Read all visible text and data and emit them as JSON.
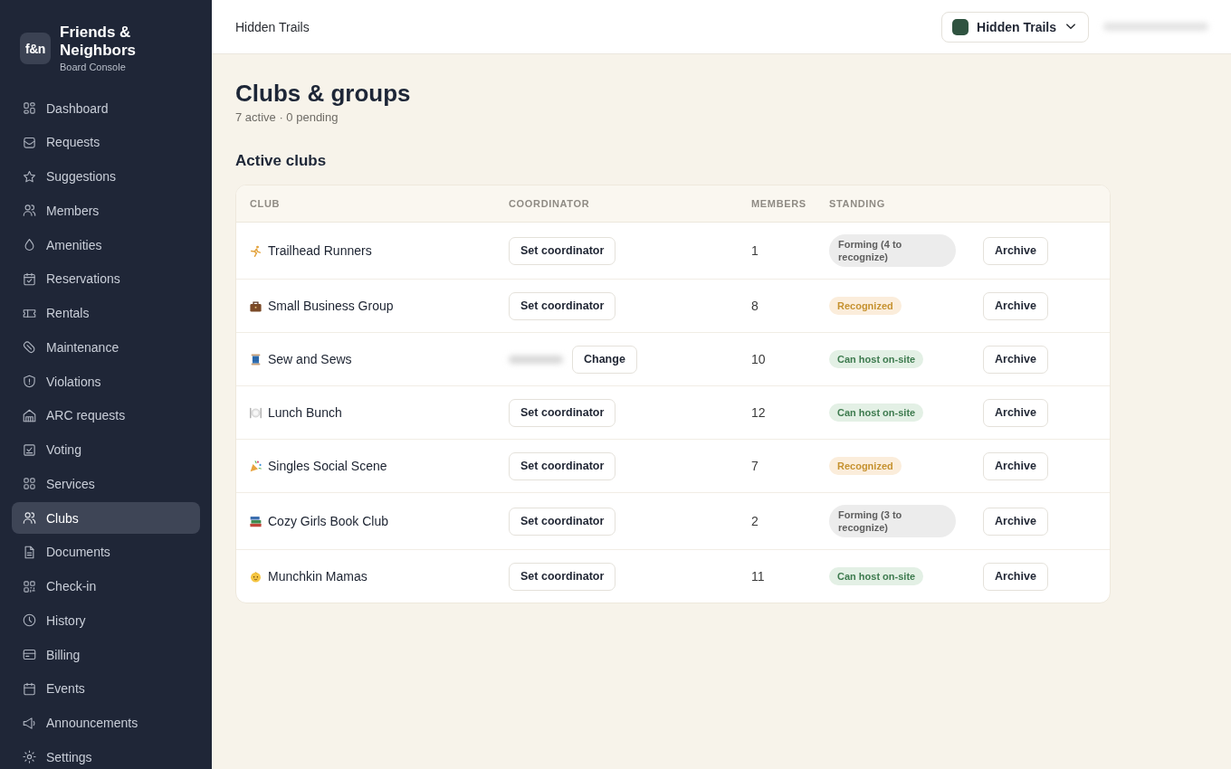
{
  "sidebar": {
    "brand": {
      "logo": "f&n",
      "name": "Friends & Neighbors",
      "subtitle": "Board Console"
    },
    "items": [
      {
        "label": "Dashboard",
        "kind": "layout",
        "selected": false
      },
      {
        "label": "Requests",
        "kind": "inbox",
        "selected": false
      },
      {
        "label": "Suggestions",
        "kind": "star",
        "selected": false
      },
      {
        "label": "Members",
        "kind": "people",
        "selected": false
      },
      {
        "label": "Amenities",
        "kind": "drop",
        "selected": false
      },
      {
        "label": "Reservations",
        "kind": "booking",
        "selected": false
      },
      {
        "label": "Rentals",
        "kind": "ticket",
        "selected": false
      },
      {
        "label": "Maintenance",
        "kind": "pill",
        "selected": false
      },
      {
        "label": "Violations",
        "kind": "shield",
        "selected": false
      },
      {
        "label": "ARC requests",
        "kind": "house",
        "selected": false
      },
      {
        "label": "Voting",
        "kind": "ballot",
        "selected": false
      },
      {
        "label": "Services",
        "kind": "grid",
        "selected": false
      },
      {
        "label": "Clubs",
        "kind": "people",
        "selected": true
      },
      {
        "label": "Documents",
        "kind": "file",
        "selected": false
      },
      {
        "label": "Check-in",
        "kind": "qr",
        "selected": false
      },
      {
        "label": "History",
        "kind": "clock",
        "selected": false
      },
      {
        "label": "Billing",
        "kind": "card",
        "selected": false
      },
      {
        "label": "Events",
        "kind": "calendar",
        "selected": false
      },
      {
        "label": "Announcements",
        "kind": "megaphone",
        "selected": false
      },
      {
        "label": "Settings",
        "kind": "gear",
        "selected": false
      }
    ]
  },
  "top_bar": {
    "title": "Hidden Trails",
    "switcher": {
      "label": "Hidden Trails"
    }
  },
  "page": {
    "title": "Clubs & groups",
    "subtitle": "7 active · 0 pending",
    "section_title": "Active clubs"
  },
  "table": {
    "columns": [
      "CLUB",
      "COORDINATOR",
      "MEMBERS",
      "STANDING"
    ],
    "rows": [
      {
        "kind": "running",
        "name": "Trailhead Runners",
        "coordinator": {
          "kind": "unset",
          "action": "Set coordinator"
        },
        "members": "1",
        "standing": {
          "kind": "forming",
          "label": "Forming (4 to recognize)"
        },
        "action": "Archive"
      },
      {
        "kind": "business",
        "name": "Small Business Group",
        "coordinator": {
          "kind": "unset",
          "action": "Set coordinator"
        },
        "members": "8",
        "standing": {
          "kind": "recognized",
          "label": "Recognized"
        },
        "action": "Archive"
      },
      {
        "kind": "sewing",
        "name": "Sew and Sews",
        "coordinator": {
          "kind": "assigned",
          "action": "Change"
        },
        "members": "10",
        "standing": {
          "kind": "onsite",
          "label": "Can host on-site"
        },
        "action": "Archive"
      },
      {
        "kind": "dining",
        "name": "Lunch Bunch",
        "coordinator": {
          "kind": "unset",
          "action": "Set coordinator"
        },
        "members": "12",
        "standing": {
          "kind": "onsite",
          "label": "Can host on-site"
        },
        "action": "Archive"
      },
      {
        "kind": "party",
        "name": "Singles Social Scene",
        "coordinator": {
          "kind": "unset",
          "action": "Set coordinator"
        },
        "members": "7",
        "standing": {
          "kind": "recognized",
          "label": "Recognized"
        },
        "action": "Archive"
      },
      {
        "kind": "books",
        "name": "Cozy Girls Book Club",
        "coordinator": {
          "kind": "unset",
          "action": "Set coordinator"
        },
        "members": "2",
        "standing": {
          "kind": "forming",
          "label": "Forming (3 to recognize)"
        },
        "action": "Archive"
      },
      {
        "kind": "baby",
        "name": "Munchkin Mamas",
        "coordinator": {
          "kind": "unset",
          "action": "Set coordinator"
        },
        "members": "11",
        "standing": {
          "kind": "onsite",
          "label": "Can host on-site"
        },
        "action": "Archive"
      }
    ]
  }
}
